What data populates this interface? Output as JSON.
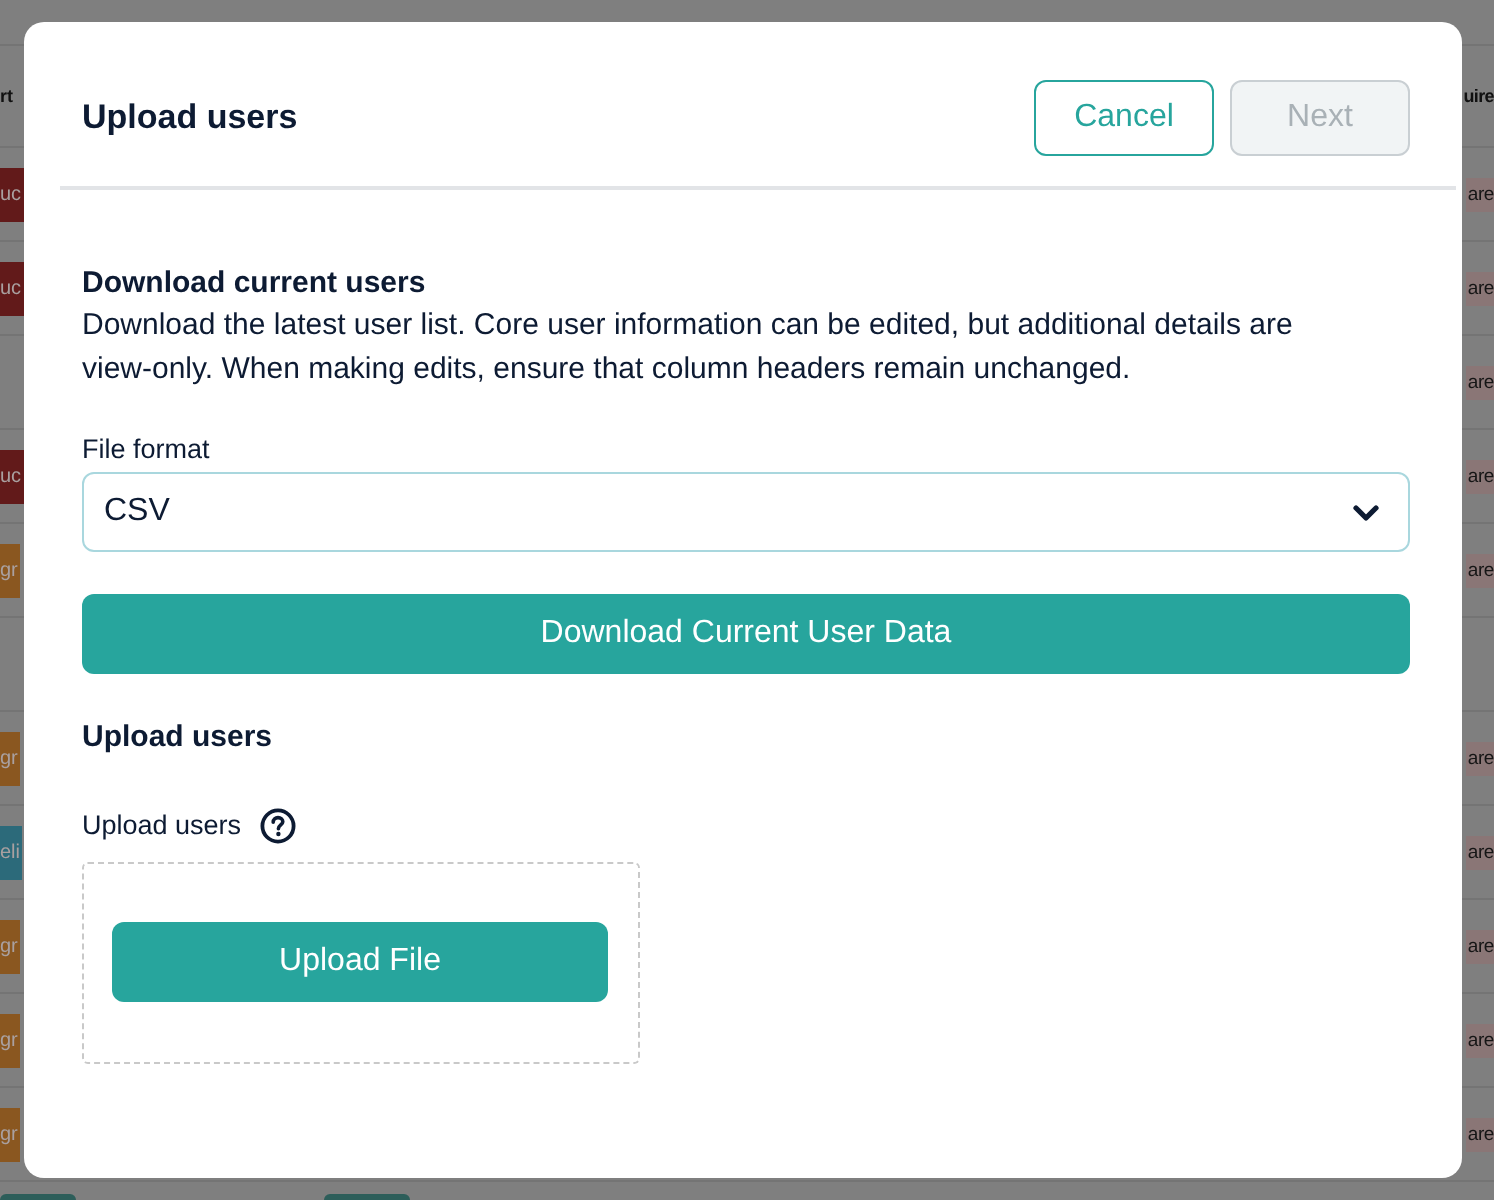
{
  "background_table": {
    "columns": [
      "rt",
      "uire"
    ],
    "rows": [
      {
        "column_1": {
          "text": "uc",
          "color": "#621a1a"
        },
        "column_2": "are"
      },
      {
        "column_1": {
          "text": "uc",
          "color": "#621a1a"
        },
        "column_2": "are"
      },
      {
        "column_2": "are"
      },
      {
        "column_1": {
          "text": "uc",
          "color": "#621a1a"
        },
        "column_2": "are"
      },
      {
        "column_1": {
          "text": "gr",
          "color": "#8a5720"
        },
        "column_2": "are"
      },
      {},
      {
        "column_1": {
          "text": "gr",
          "color": "#8a5720"
        },
        "column_2": "are"
      },
      {
        "column_1": {
          "text": "eli",
          "color": "#2c6a7a"
        },
        "column_2": "are"
      },
      {
        "column_1": {
          "text": "gr",
          "color": "#8a5720"
        },
        "column_2": "are"
      },
      {
        "column_1": {
          "text": "gr",
          "color": "#8a5720"
        },
        "column_2": "are"
      },
      {
        "column_1": {
          "text": "gr",
          "color": "#8a5720"
        },
        "column_2": "are"
      }
    ]
  },
  "dialog": {
    "title": "Upload users",
    "buttons": [
      {
        "label": "Cancel",
        "disabled": false
      },
      {
        "label": "Next",
        "disabled": true
      }
    ]
  },
  "download_section": {
    "heading": "Download current users",
    "description": "Download the latest user list. Core user information can be edited, but additional details are view-only. When making edits, ensure that column headers remain unchanged.",
    "file_format": {
      "label": "File format",
      "value": "CSV"
    },
    "button": "Download Current User Data"
  },
  "upload_section": {
    "heading": "Upload users",
    "field_label": "Upload users",
    "button": "Upload File"
  }
}
